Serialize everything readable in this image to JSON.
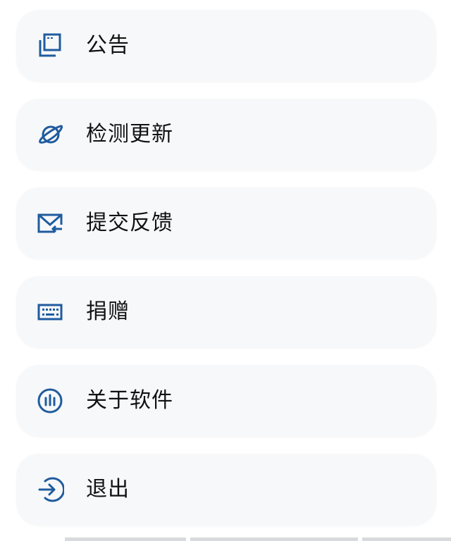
{
  "colors": {
    "icon_accent": "#1f5b9e",
    "card_background": "#f7f8fa",
    "text": "#111111"
  },
  "menu": {
    "items": [
      {
        "label": "公告",
        "icon": "announcement-icon"
      },
      {
        "label": "检测更新",
        "icon": "planet-icon"
      },
      {
        "label": "提交反馈",
        "icon": "mail-feedback-icon"
      },
      {
        "label": "捐赠",
        "icon": "keyboard-icon"
      },
      {
        "label": "关于软件",
        "icon": "bars-circle-icon"
      },
      {
        "label": "退出",
        "icon": "logout-icon"
      }
    ]
  }
}
